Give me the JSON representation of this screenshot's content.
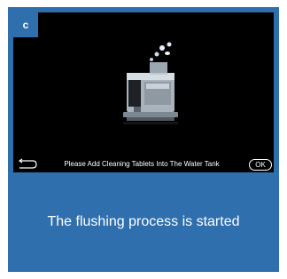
{
  "screen": {
    "step_label": "c",
    "instruction": "Please Add Cleaning Tablets Into The Water Tank",
    "ok_label": "OK",
    "back_icon": "return-arrow-icon",
    "illustration": "coffee-machine-with-tablets"
  },
  "caption": "The flushing process is started",
  "colors": {
    "accent": "#2f6fae",
    "screen_bg": "#000000",
    "text": "#ffffff"
  }
}
